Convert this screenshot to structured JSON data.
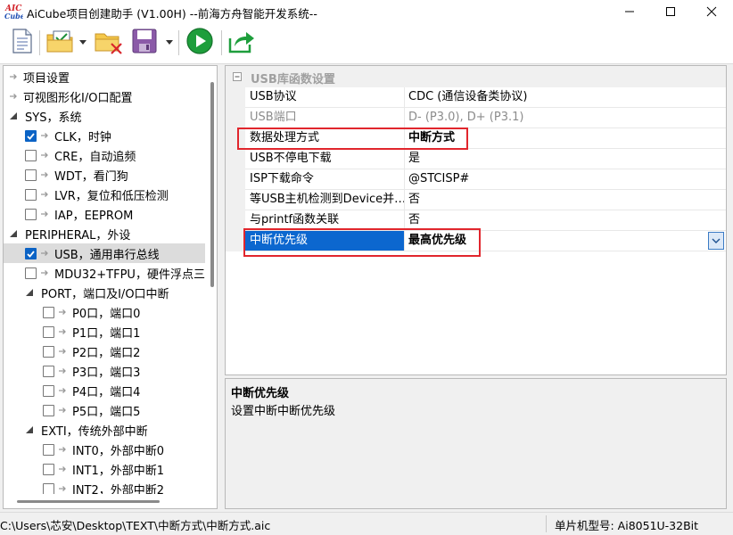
{
  "window": {
    "title": "AiCube项目创建助手 (V1.00H) --前海方舟智能开发系统--",
    "logo_line1": "AIC",
    "logo_line2": "Cube"
  },
  "toolbar": {
    "buttons": [
      "new-document-icon",
      "open-project-icon",
      "close-project-icon",
      "save-icon",
      "run-icon",
      "export-icon"
    ]
  },
  "tree": {
    "items": [
      {
        "label": "项目设置",
        "kind": "leaf",
        "level": 0
      },
      {
        "label": "可视图形化I/O口配置",
        "kind": "leaf",
        "level": 0
      },
      {
        "label": "SYS，系统",
        "kind": "group",
        "level": 0
      },
      {
        "label": "CLK，时钟",
        "kind": "check",
        "checked": true,
        "level": 1
      },
      {
        "label": "CRE，自动追频",
        "kind": "check",
        "checked": false,
        "level": 1
      },
      {
        "label": "WDT，看门狗",
        "kind": "check",
        "checked": false,
        "level": 1
      },
      {
        "label": "LVR，复位和低压检测",
        "kind": "check",
        "checked": false,
        "level": 1
      },
      {
        "label": "IAP，EEPROM",
        "kind": "check",
        "checked": false,
        "level": 1
      },
      {
        "label": "PERIPHERAL，外设",
        "kind": "group",
        "level": 0
      },
      {
        "label": "USB，通用串行总线",
        "kind": "check",
        "checked": true,
        "level": 1,
        "selected": true
      },
      {
        "label": "MDU32+TFPU，硬件浮点三",
        "kind": "check",
        "checked": false,
        "level": 1
      },
      {
        "label": "PORT，端口及I/O口中断",
        "kind": "group",
        "level": 1
      },
      {
        "label": "P0口，端口0",
        "kind": "check",
        "checked": false,
        "level": 2
      },
      {
        "label": "P1口，端口1",
        "kind": "check",
        "checked": false,
        "level": 2
      },
      {
        "label": "P2口，端口2",
        "kind": "check",
        "checked": false,
        "level": 2
      },
      {
        "label": "P3口，端口3",
        "kind": "check",
        "checked": false,
        "level": 2
      },
      {
        "label": "P4口，端口4",
        "kind": "check",
        "checked": false,
        "level": 2
      },
      {
        "label": "P5口，端口5",
        "kind": "check",
        "checked": false,
        "level": 2
      },
      {
        "label": "EXTI，传统外部中断",
        "kind": "group",
        "level": 1
      },
      {
        "label": "INT0，外部中断0",
        "kind": "check",
        "checked": false,
        "level": 2
      },
      {
        "label": "INT1，外部中断1",
        "kind": "check",
        "checked": false,
        "level": 2
      },
      {
        "label": "INT2，外部中断2",
        "kind": "check",
        "checked": false,
        "level": 2
      }
    ]
  },
  "properties": {
    "group_label": "USB库函数设置",
    "rows": [
      {
        "name": "USB协议",
        "value": "CDC (通信设备类协议)",
        "state": "normal"
      },
      {
        "name": "USB端口",
        "value": "D- (P3.0), D+ (P3.1)",
        "state": "disabled"
      },
      {
        "name": "数据处理方式",
        "value": "中断方式",
        "state": "bold"
      },
      {
        "name": "USB不停电下载",
        "value": "是",
        "state": "normal"
      },
      {
        "name": "ISP下载命令",
        "value": "@STCISP#",
        "state": "normal"
      },
      {
        "name": "等USB主机检测到Device并…",
        "value": "否",
        "state": "normal"
      },
      {
        "name": "与printf函数关联",
        "value": "否",
        "state": "normal"
      },
      {
        "name": "中断优先级",
        "value": "最高优先级",
        "state": "selected"
      }
    ]
  },
  "description": {
    "title": "中断优先级",
    "text": "设置中断中断优先级"
  },
  "status": {
    "path": "C:\\Users\\芯安\\Desktop\\TEXT\\中断方式\\中断方式.aic",
    "chip": "单片机型号:  Ai8051U-32Bit"
  },
  "colors": {
    "accent": "#0c67cf",
    "highlight": "#e1262d",
    "checkbox": "#0b63c5"
  }
}
